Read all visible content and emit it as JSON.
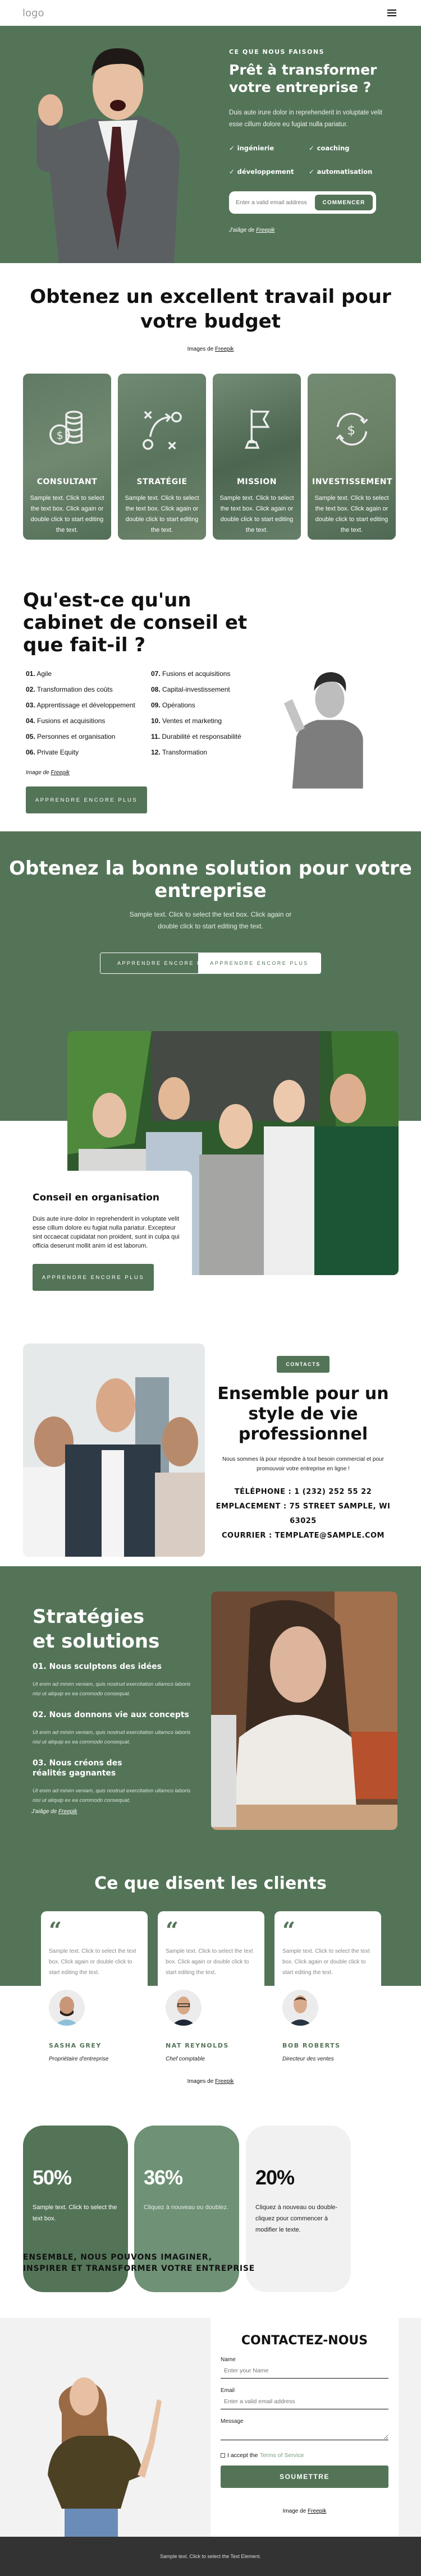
{
  "header": {
    "logo": "logo",
    "menu_icon": "hamburger-icon"
  },
  "colors": {
    "brand_green": "#547458",
    "light_green": "#6f9176",
    "light_gray": "#f1f1f1",
    "footer": "#333333"
  },
  "hero": {
    "eyebrow": "CE QUE NOUS FAISONS",
    "title": "Prêt à transformer votre entreprise ?",
    "text": "Duis aute irure dolor in reprehenderit in voluptate velit esse cillum dolore eu fugiat nulla pariatur.",
    "features": [
      "ingénierie",
      "coaching",
      "développement",
      "automatisation"
    ],
    "email_placeholder": "Enter a valid email address",
    "cta": "COMMENCER",
    "credit_prefix": "J'aiâge de ",
    "credit_link": "Freepik"
  },
  "services": {
    "title": "Obtenez un excellent travail pour votre budget",
    "credit_prefix": "Images de ",
    "credit_link": "Freepik",
    "cards": [
      {
        "icon": "coins-dollar-icon",
        "title": "CONSULTANT",
        "text": "Sample text. Click to select the text box. Click again or double click to start editing the text."
      },
      {
        "icon": "strategy-play-icon",
        "title": "STRATÉGIE",
        "text": "Sample text. Click to select the text box. Click again or double click to start editing the text."
      },
      {
        "icon": "flag-icon",
        "title": "MISSION",
        "text": "Sample text. Click to select the text box. Click again or double click to start editing the text."
      },
      {
        "icon": "dollar-cycle-icon",
        "title": "INVESTISSEMENT",
        "text": "Sample text. Click to select the text box. Click again or double click to start editing the text."
      }
    ]
  },
  "consulting": {
    "title": "Qu'est-ce qu'un cabinet de conseil et que fait-il ?",
    "items": [
      {
        "num": "01.",
        "label": "Agile"
      },
      {
        "num": "07.",
        "label": "Fusions et acquisitions"
      },
      {
        "num": "02.",
        "label": "Transformation des coûts"
      },
      {
        "num": "08.",
        "label": "Capital-investissement"
      },
      {
        "num": "03.",
        "label": "Apprentissage et développement"
      },
      {
        "num": "09.",
        "label": "Opérations"
      },
      {
        "num": "04.",
        "label": "Fusions et acquisitions"
      },
      {
        "num": "10.",
        "label": "Ventes et marketing"
      },
      {
        "num": "05.",
        "label": "Personnes et organisation"
      },
      {
        "num": "11.",
        "label": "Durabilité et responsabilité"
      },
      {
        "num": "06.",
        "label": "Private Equity"
      },
      {
        "num": "12.",
        "label": "Transformation"
      }
    ],
    "credit_prefix": "Image de ",
    "credit_link": "Freepik",
    "button": "APPRENDRE ENCORE PLUS"
  },
  "solution": {
    "title": "Obtenez la bonne solution pour votre entreprise",
    "text": "Sample text. Click to select the text box. Click again or double click to start editing the text.",
    "button1": "APPRENDRE ENCORE PLUS",
    "button2": "APPRENDRE ENCORE PLUS"
  },
  "organisation": {
    "title": "Conseil en organisation",
    "text": "Duis aute irure dolor in reprehenderit in voluptate velit esse cillum dolore eu fugiat nulla pariatur. Excepteur sint occaecat cupidatat non proident, sunt in culpa qui officia deserunt mollit anim id est laborum.",
    "button": "APPRENDRE ENCORE PLUS"
  },
  "contacts": {
    "badge": "CONTACTS",
    "title": "Ensemble pour un style de vie professionnel",
    "text": "Nous sommes là pour répondre à tout besoin commercial et pour promouvoir votre entreprise en ligne !",
    "phone": "TÉLÉPHONE : 1 (232) 252 55 22",
    "location": "EMPLACEMENT : 75 STREET SAMPLE, WI 63025",
    "mail": "COURRIER : TEMPLATE@SAMPLE.COM"
  },
  "strategies": {
    "title": "Stratégies et solutions",
    "items": [
      {
        "title": "01. Nous sculptons des idées",
        "text": "Ut enim ad minim veniam, quis nostrud exercitation ullamco laboris nisi ut aliquip ex ea commodo consequat."
      },
      {
        "title": "02. Nous donnons vie aux concepts",
        "text": "Ut enim ad minim veniam, quis nostrud exercitation ullamco laboris nisi ut aliquip ex ea commodo consequat."
      },
      {
        "title": "03. Nous créons des réalités gagnantes",
        "text": "Ut enim ad minim veniam, quis nostrud exercitation ullamco laboris nisi ut aliquip ex ea commodo consequat."
      }
    ],
    "credit_prefix": "J'aiâge de ",
    "credit_link": "Freepik"
  },
  "testimonials": {
    "title": "Ce que disent les clients",
    "items": [
      {
        "text": "Sample text. Click to select the text box. Click again or double click to start editing the text.",
        "name": "SASHA GREY",
        "role": "Propriétaire d'entreprise"
      },
      {
        "text": "Sample text. Click to select the text box. Click again or double click to start editing the text.",
        "name": "NAT REYNOLDS",
        "role": "Chef comptable"
      },
      {
        "text": "Sample text. Click to select the text box. Click again or double click to start editing the text.",
        "name": "BOB ROBERTS",
        "role": "Directeur des ventes"
      }
    ],
    "credit_prefix": "Images de ",
    "credit_link": "Freepik"
  },
  "stats": {
    "items": [
      {
        "value": "50%",
        "text": "Sample text. Click to select the text box."
      },
      {
        "value": "36%",
        "text": "Cliquez à nouveau ou doublez."
      },
      {
        "value": "20%",
        "text": "Cliquez à nouveau ou double-cliquez pour commencer à modifier le texte."
      }
    ],
    "tagline": "ENSEMBLE, NOUS POUVONS IMAGINER, INSPIRER ET TRANSFORMER VOTRE ENTREPRISE"
  },
  "contact_form": {
    "title": "CONTACTEZ-NOUS",
    "name_label": "Name",
    "name_placeholder": "Enter your Name",
    "email_label": "Email",
    "email_placeholder": "Enter a valid email address",
    "message_label": "Message",
    "message_value": "",
    "terms_prefix": "I accept the ",
    "terms_link": "Terms of Service",
    "submit": "SOUMETTRE",
    "credit_prefix": "Image de ",
    "credit_link": "Freepik"
  },
  "footer": {
    "text": "Sample text. Click to select the Text Element."
  }
}
